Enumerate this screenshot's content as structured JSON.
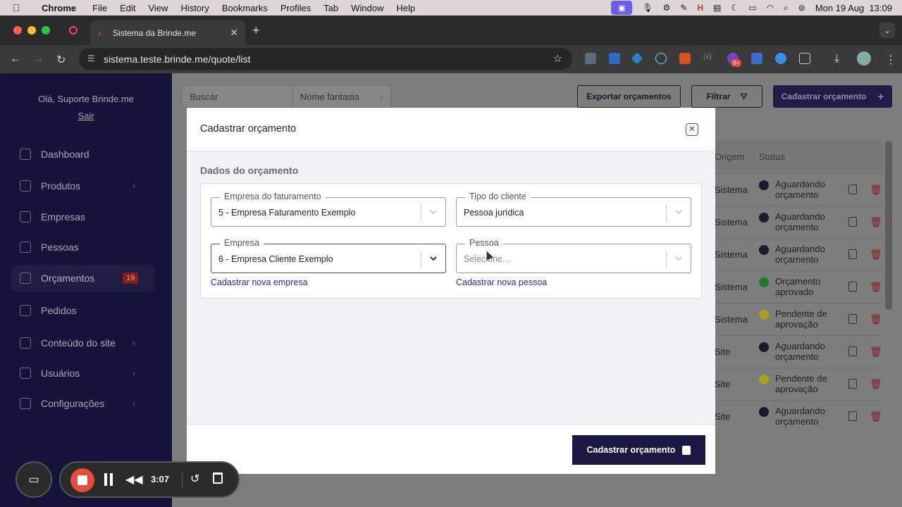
{
  "menubar": {
    "app": "Chrome",
    "items": [
      "File",
      "Edit",
      "View",
      "History",
      "Bookmarks",
      "Profiles",
      "Tab",
      "Window",
      "Help"
    ],
    "datetime": "Mon 19 Aug  13:09"
  },
  "browser": {
    "tab_title": "Sistema da Brinde.me",
    "url": "sistema.teste.brinde.me/quote/list",
    "ext_badge": "9+"
  },
  "sidebar": {
    "greeting": "Olá, Suporte Brinde.me",
    "logout": "Sair",
    "items": [
      {
        "label": "Dashboard",
        "icon": "chart-icon"
      },
      {
        "label": "Produtos",
        "icon": "box-icon",
        "has_submenu": true
      },
      {
        "label": "Empresas",
        "icon": "building-icon"
      },
      {
        "label": "Pessoas",
        "icon": "id-card-icon"
      },
      {
        "label": "Orçamentos",
        "icon": "calculator-icon",
        "badge": "19",
        "active": true
      },
      {
        "label": "Pedidos",
        "icon": "clipboard-icon"
      },
      {
        "label": "Conteúdo do site",
        "icon": "layout-icon",
        "has_submenu": true
      },
      {
        "label": "Usuários",
        "icon": "users-icon",
        "has_submenu": true
      },
      {
        "label": "Configurações",
        "icon": "gear-icon",
        "has_submenu": true
      }
    ]
  },
  "toolbar": {
    "search_placeholder": "Buscar",
    "search_field": "Nome fantasia",
    "export_label": "Exportar orçamentos",
    "filter_label": "Filtrar",
    "create_label": "Cadastrar orçamento"
  },
  "table": {
    "headers": [
      "Origem",
      "Status"
    ],
    "rows": [
      {
        "origem": "Sistema",
        "status": [
          "Aguardando",
          "orçamento"
        ],
        "color": "#1a1a2e"
      },
      {
        "origem": "Sistema",
        "status": [
          "Aguardando",
          "orçamento"
        ],
        "color": "#1a1a2e"
      },
      {
        "origem": "Sistema",
        "status": [
          "Aguardando",
          "orçamento"
        ],
        "color": "#1a1a2e"
      },
      {
        "origem": "Sistema",
        "status": [
          "Orçamento",
          "aprovado"
        ],
        "color": "#1b7a2b"
      },
      {
        "origem": "Sistema",
        "status": [
          "Pendente de",
          "aprovação"
        ],
        "color": "#a8a020"
      },
      {
        "origem": "Site",
        "status": [
          "Aguardando",
          "orçamento"
        ],
        "color": "#1a1a2e"
      },
      {
        "origem": "Site",
        "status": [
          "Pendente de",
          "aprovação"
        ],
        "color": "#a8a020"
      },
      {
        "origem": "Site",
        "status": [
          "Aguardando",
          "orçamento"
        ],
        "color": "#1a1a2e"
      }
    ]
  },
  "modal": {
    "title": "Cadastrar orçamento",
    "section": "Dados do orçamento",
    "fields": {
      "empresa_faturamento": {
        "label": "Empresa do faturamento",
        "value": "5 - Empresa Faturamento Exemplo"
      },
      "tipo_cliente": {
        "label": "Tipo do cliente",
        "value": "Pessoa jurídica"
      },
      "empresa": {
        "label": "Empresa",
        "value": "6 - Empresa Cliente Exemplo"
      },
      "pessoa": {
        "label": "Pessoa",
        "placeholder": "Selecione..."
      }
    },
    "link_empresa": "Cadastrar nova empresa",
    "link_pessoa": "Cadastrar nova pessoa",
    "submit_label": "Cadastrar orçamento"
  },
  "recorder": {
    "time": "3:07"
  }
}
